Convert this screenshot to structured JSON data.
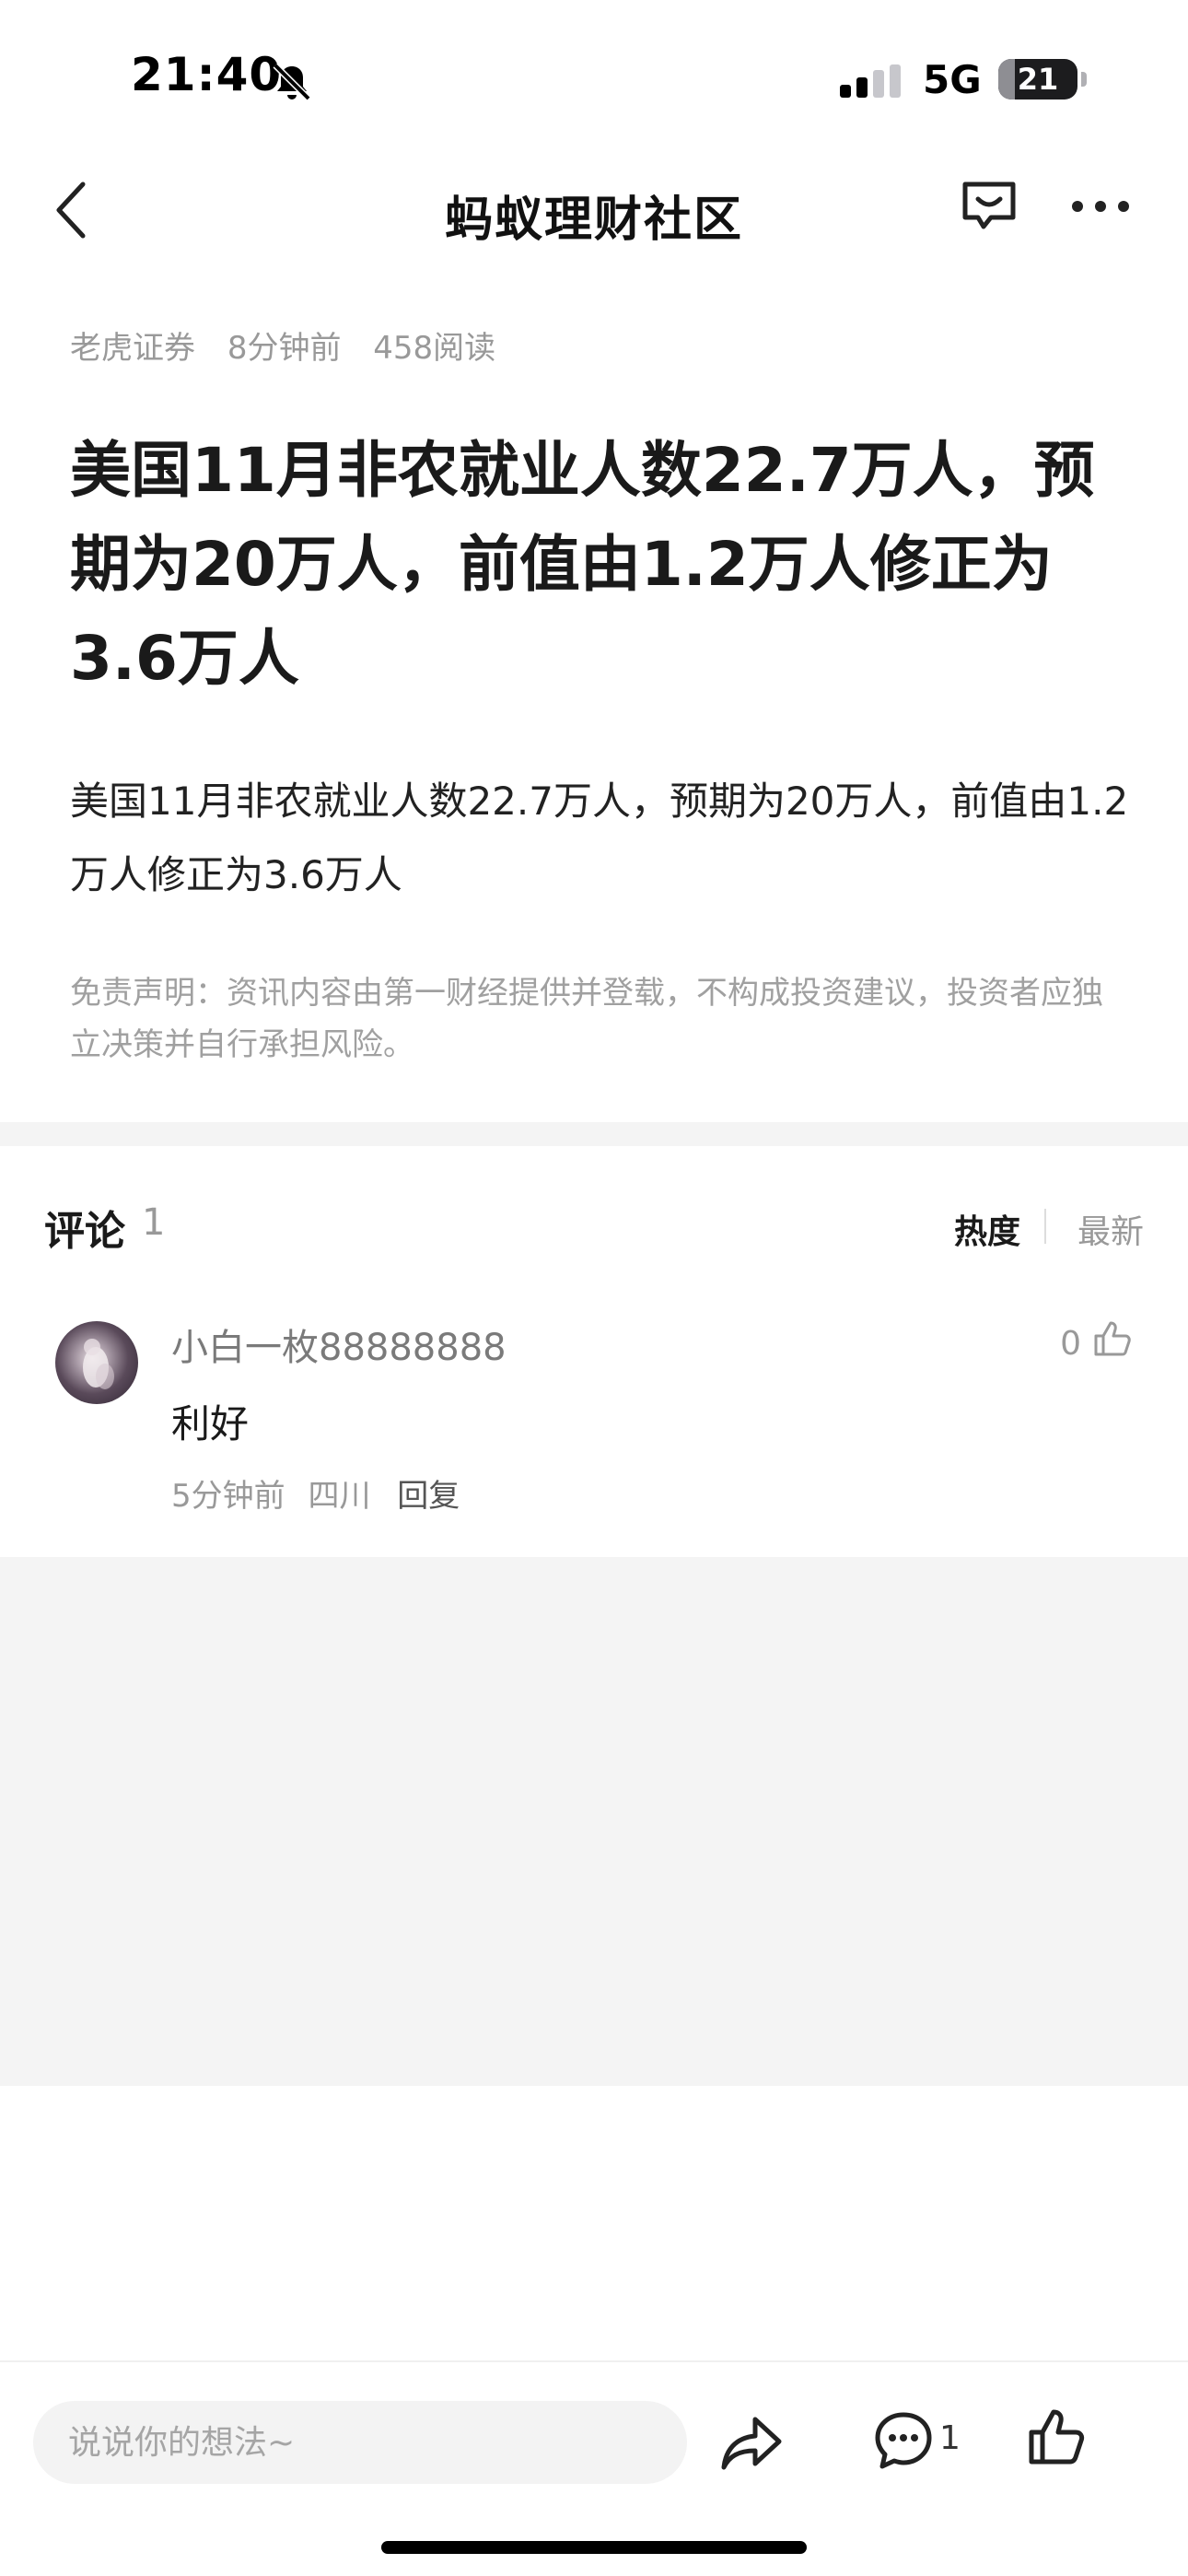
{
  "status_bar": {
    "time": "21:40",
    "network": "5G",
    "battery_level": "21",
    "battery_fraction": 0.21
  },
  "nav": {
    "title": "蚂蚁理财社区"
  },
  "article": {
    "source": "老虎证券",
    "time_ago": "8分钟前",
    "reads": "458阅读",
    "title": "美国11月非农就业人数22.7万人，预期为20万人，前值由1.2万人修正为3.6万人",
    "body": "美国11月非农就业人数22.7万人，预期为20万人，前值由1.2万人修正为3.6万人",
    "disclaimer": "免责声明：资讯内容由第一财经提供并登载，不构成投资建议，投资者应独立决策并自行承担风险。"
  },
  "comments": {
    "title": "评论",
    "count": "1",
    "sort_hot": "热度",
    "sort_new": "最新",
    "items": [
      {
        "user": "小白一枚88888888",
        "text": "利好",
        "time_ago": "5分钟前",
        "location": "四川",
        "reply_label": "回复",
        "likes": "0"
      }
    ]
  },
  "bottom_bar": {
    "input_placeholder": "说说你的想法~",
    "comment_count": "1"
  },
  "colors": {
    "accent_text": "#1a1a1a",
    "muted_text": "#999999",
    "divider_bg": "#f4f4f4"
  },
  "icons": [
    "bell-slash-icon",
    "signal-icon",
    "battery-icon",
    "back-icon",
    "message-icon",
    "more-icon",
    "thumbs-up-icon",
    "share-icon",
    "comment-bubble-icon"
  ]
}
